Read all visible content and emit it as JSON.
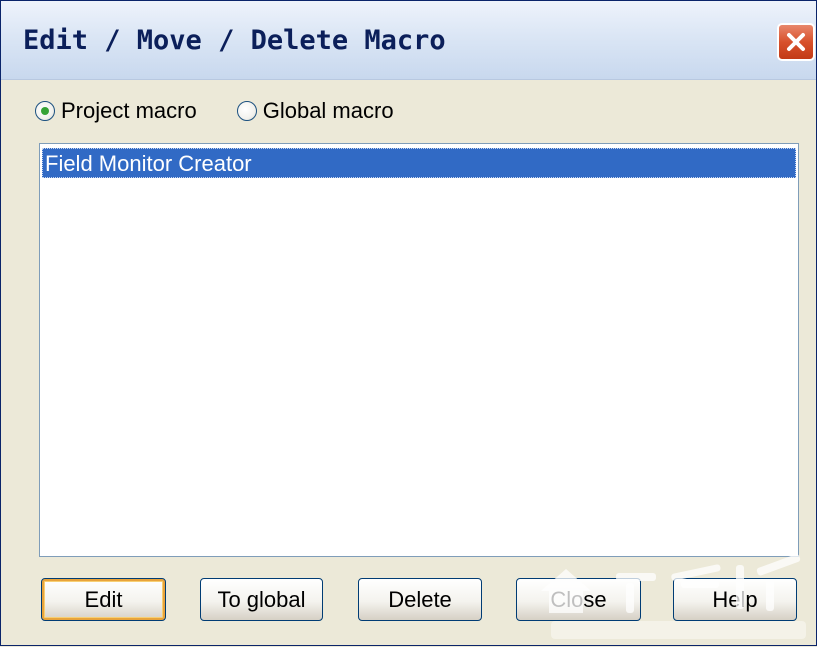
{
  "window": {
    "title": "Edit / Move / Delete Macro"
  },
  "radios": [
    {
      "label": "Project macro",
      "checked": true
    },
    {
      "label": "Global macro",
      "checked": false
    }
  ],
  "macro_list": {
    "items": [
      {
        "label": "Field Monitor Creator",
        "selected": true
      }
    ]
  },
  "buttons": {
    "edit": "Edit",
    "to_global": "To global",
    "delete": "Delete",
    "close": "Close",
    "help": "Help"
  },
  "colors": {
    "selection": "#316ac5",
    "title_text": "#0b1f5a",
    "close_button": "#d8512c",
    "radio_dot": "#36a336",
    "default_button_ring": "#e8a33b"
  },
  "icons": {
    "close": "close-icon"
  }
}
